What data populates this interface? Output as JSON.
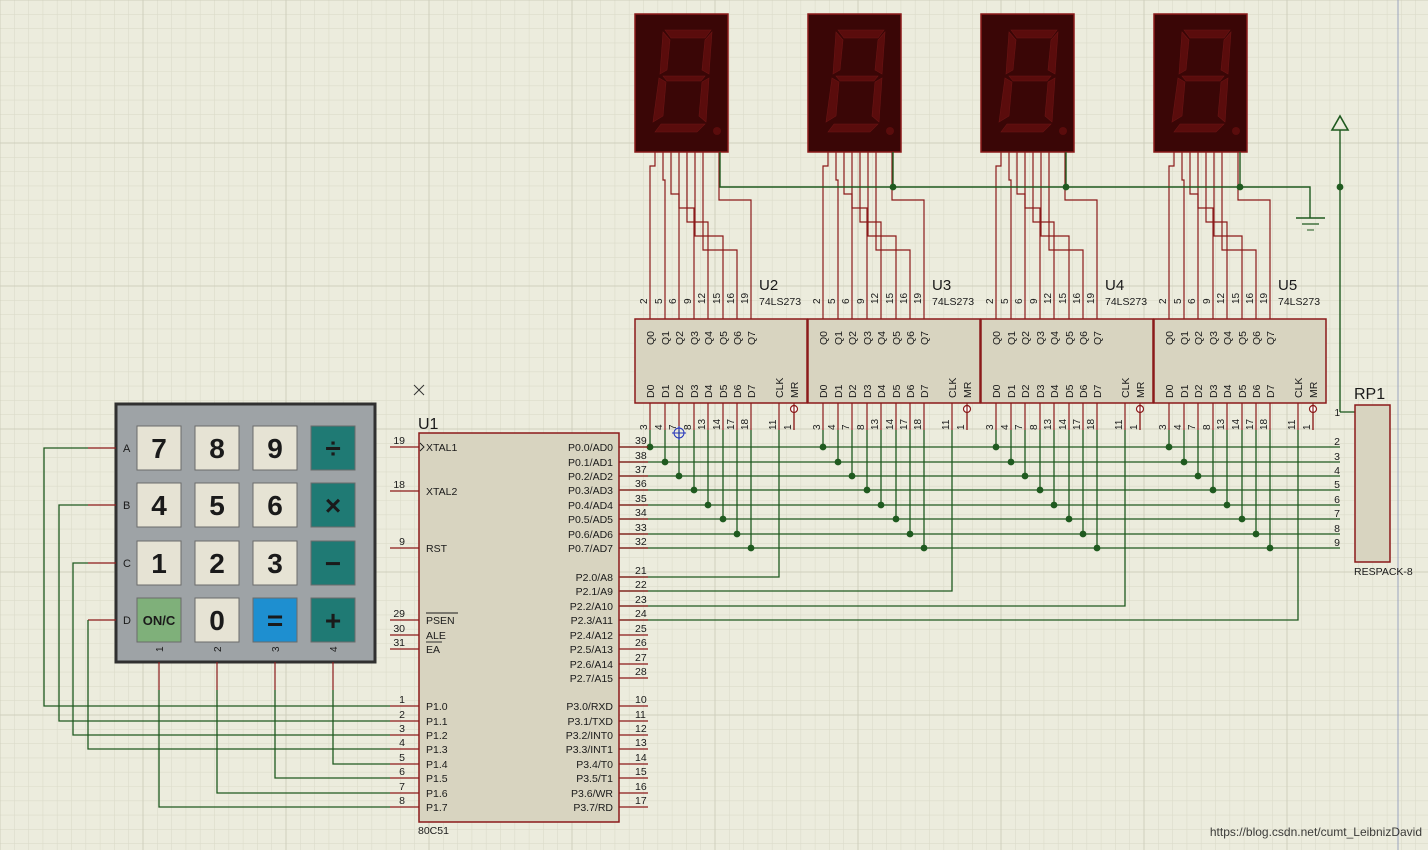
{
  "colors": {
    "background": "#ececdd",
    "grid_minor": "#dcdcca",
    "grid_major": "#cfcfbd",
    "wire": "#1f5a1f",
    "component_outline": "#8b1a1a",
    "chip_fill": "#d8d4c0",
    "segment_off": "#5a0c0c",
    "display_fill": "#3a0606",
    "keypad_body": "#9ea3a6",
    "key_light": "#e6e3d4",
    "key_teal": "#1f7a74",
    "key_green": "#7fb07a",
    "key_blue": "#1e8fd0"
  },
  "mcu": {
    "name": "U1",
    "part": "80C51",
    "left_pins": [
      {
        "num": "19",
        "label": "XTAL1"
      },
      {
        "num": "18",
        "label": "XTAL2"
      },
      {
        "num": "9",
        "label": "RST"
      },
      {
        "num": "29",
        "label": "PSEN"
      },
      {
        "num": "30",
        "label": "ALE"
      },
      {
        "num": "31",
        "label": "EA"
      },
      {
        "num": "1",
        "label": "P1.0"
      },
      {
        "num": "2",
        "label": "P1.1"
      },
      {
        "num": "3",
        "label": "P1.2"
      },
      {
        "num": "4",
        "label": "P1.3"
      },
      {
        "num": "5",
        "label": "P1.4"
      },
      {
        "num": "6",
        "label": "P1.5"
      },
      {
        "num": "7",
        "label": "P1.6"
      },
      {
        "num": "8",
        "label": "P1.7"
      }
    ],
    "right_pins": [
      {
        "num": "39",
        "label": "P0.0/AD0"
      },
      {
        "num": "38",
        "label": "P0.1/AD1"
      },
      {
        "num": "37",
        "label": "P0.2/AD2"
      },
      {
        "num": "36",
        "label": "P0.3/AD3"
      },
      {
        "num": "35",
        "label": "P0.4/AD4"
      },
      {
        "num": "34",
        "label": "P0.5/AD5"
      },
      {
        "num": "33",
        "label": "P0.6/AD6"
      },
      {
        "num": "32",
        "label": "P0.7/AD7"
      },
      {
        "num": "21",
        "label": "P2.0/A8"
      },
      {
        "num": "22",
        "label": "P2.1/A9"
      },
      {
        "num": "23",
        "label": "P2.2/A10"
      },
      {
        "num": "24",
        "label": "P2.3/A11"
      },
      {
        "num": "25",
        "label": "P2.4/A12"
      },
      {
        "num": "26",
        "label": "P2.5/A13"
      },
      {
        "num": "27",
        "label": "P2.6/A14"
      },
      {
        "num": "28",
        "label": "P2.7/A15"
      },
      {
        "num": "10",
        "label": "P3.0/RXD"
      },
      {
        "num": "11",
        "label": "P3.1/TXD"
      },
      {
        "num": "12",
        "label": "P3.2/INT0"
      },
      {
        "num": "13",
        "label": "P3.3/INT1"
      },
      {
        "num": "14",
        "label": "P3.4/T0"
      },
      {
        "num": "15",
        "label": "P3.5/T1"
      },
      {
        "num": "16",
        "label": "P3.6/WR"
      },
      {
        "num": "17",
        "label": "P3.7/RD"
      }
    ]
  },
  "latches": [
    {
      "name": "U2",
      "part": "74LS273"
    },
    {
      "name": "U3",
      "part": "74LS273"
    },
    {
      "name": "U4",
      "part": "74LS273"
    },
    {
      "name": "U5",
      "part": "74LS273"
    }
  ],
  "latch_pins": {
    "q_labels": [
      "Q0",
      "Q1",
      "Q2",
      "Q3",
      "Q4",
      "Q5",
      "Q6",
      "Q7"
    ],
    "q_nums": [
      "2",
      "5",
      "6",
      "9",
      "12",
      "15",
      "16",
      "19"
    ],
    "d_labels": [
      "D0",
      "D1",
      "D2",
      "D3",
      "D4",
      "D5",
      "D6",
      "D7",
      "CLK",
      "MR"
    ],
    "d_nums": [
      "3",
      "4",
      "7",
      "8",
      "13",
      "14",
      "17",
      "18",
      "11",
      "1"
    ]
  },
  "respack": {
    "name": "RP1",
    "part": "RESPACK-8",
    "pins": [
      "1",
      "2",
      "3",
      "4",
      "5",
      "6",
      "7",
      "8",
      "9"
    ]
  },
  "keypad": {
    "row_labels": [
      "A",
      "B",
      "C",
      "D"
    ],
    "col_labels": [
      "1",
      "2",
      "3",
      "4"
    ],
    "keys": [
      [
        "7",
        "8",
        "9",
        "÷"
      ],
      [
        "4",
        "5",
        "6",
        "×"
      ],
      [
        "1",
        "2",
        "3",
        "−"
      ],
      [
        "ON/C",
        "0",
        "=",
        "+"
      ]
    ]
  },
  "watermark": "https://blog.csdn.net/cumt_LeibnizDavid"
}
